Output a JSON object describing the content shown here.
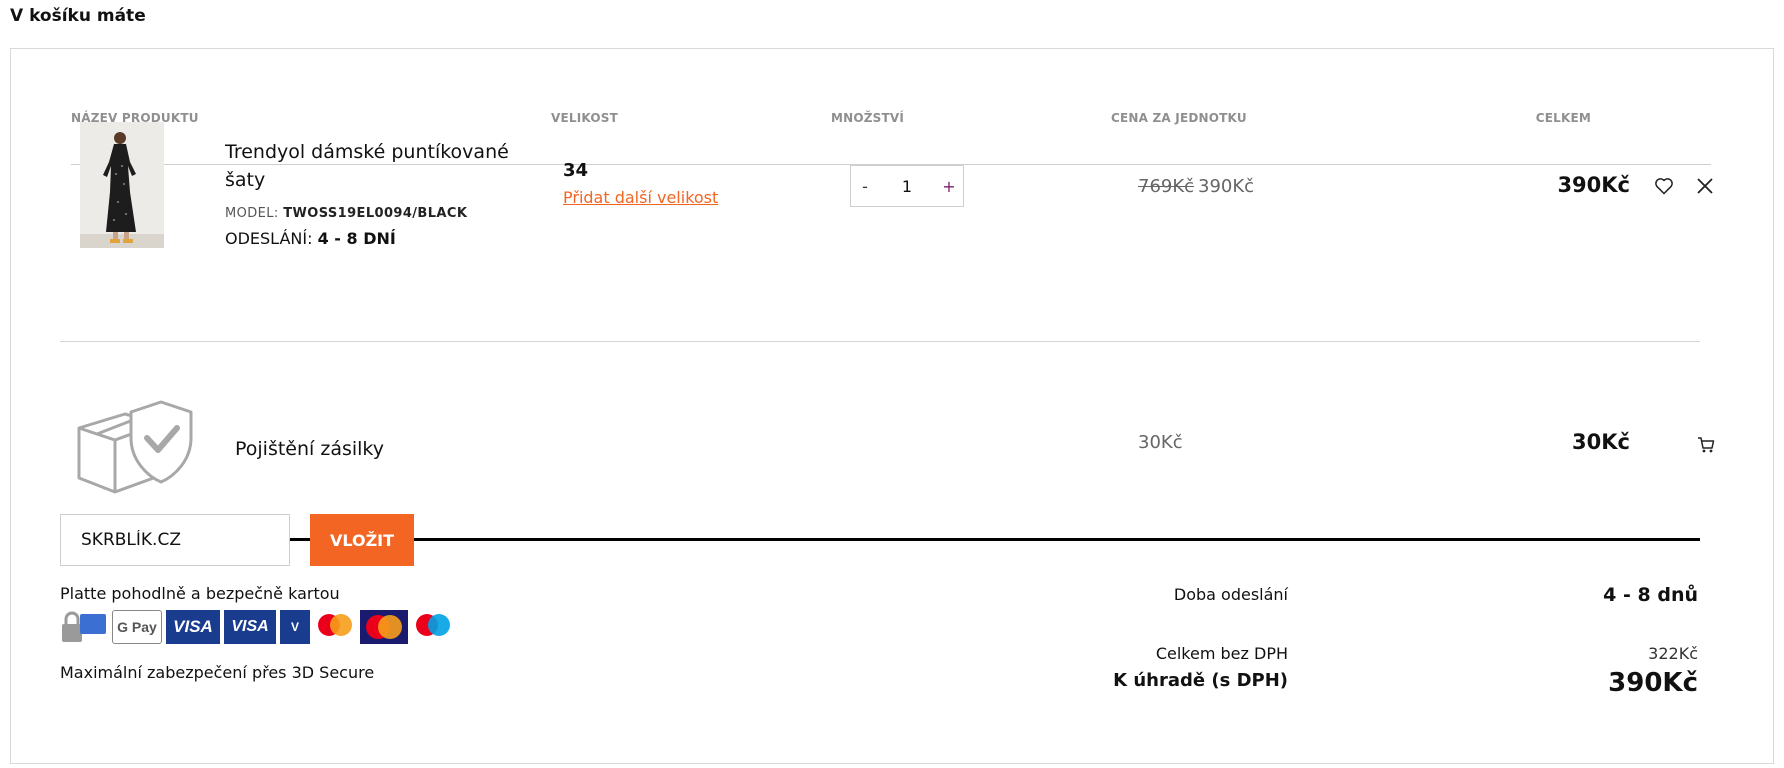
{
  "page": {
    "title": "V košíku máte"
  },
  "table": {
    "headers": [
      "NÁZEV PRODUKTU",
      "VELIKOST",
      "MNOŽSTVÍ",
      "CENA ZA JEDNOTKU",
      "CELKEM"
    ]
  },
  "product": {
    "name": "Trendyol dámské puntíkované šaty",
    "model_label": "MODEL:",
    "model": "TWOSS19EL0094/BLACK",
    "dispatch_label": "ODESLÁNÍ:",
    "dispatch": "4 - 8 DNÍ",
    "size": "34",
    "add_size": "Přidat další velikost",
    "qty_minus": "-",
    "qty": "1",
    "qty_plus": "+",
    "price_old": "769Kč",
    "price_new": "390Kč",
    "total": "390Kč",
    "icons": [
      "heart-icon",
      "close-icon"
    ]
  },
  "insurance": {
    "name": "Pojištění zásilky",
    "price": "30Kč",
    "total": "30Kč",
    "icon": "cart-icon"
  },
  "coupon": {
    "value": "SKRBLÍK.CZ",
    "button": "VLOŽIT"
  },
  "payment": {
    "text": "Platte pohodlně a bezpečně kartou",
    "secure": "Maximální zabezpečení přes 3D Secure",
    "logos": [
      "100% secure",
      "G Pay",
      "VISA",
      "VISA electron",
      "V PAY",
      "mastercard",
      "Maestro Electronic",
      "maestro"
    ]
  },
  "summary": {
    "dispatch_label": "Doba odeslání",
    "dispatch_value": "4 - 8 dnů",
    "net_label": "Celkem bez DPH",
    "net_value": "322Kč",
    "gross_label": "K úhradě (s DPH)",
    "gross_value": "390Kč"
  },
  "colors": {
    "accent": "#f26522",
    "muted": "#8f8f8f"
  }
}
